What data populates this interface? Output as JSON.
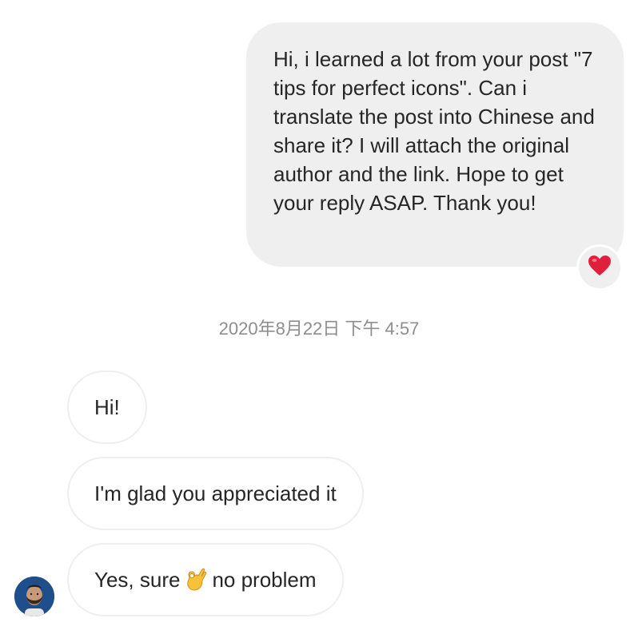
{
  "sent_message": {
    "text": "Hi, i learned a lot from your post \"7 tips for perfect icons\". Can i translate the post into Chinese and share it? I will attach the original author and the link. Hope to get your reply ASAP. Thank you!",
    "reaction_icon": "heart-icon"
  },
  "timestamp": "2020年8月22日 下午 4:57",
  "received_messages": [
    {
      "text": "Hi!"
    },
    {
      "text": "I'm glad you appreciated it"
    },
    {
      "before": "Yes, sure",
      "emoji_icon": "ok-hand-icon",
      "after": "no problem"
    }
  ],
  "avatar": {
    "icon": "avatar",
    "background": "#1f4e8c"
  },
  "colors": {
    "bubble_gray": "#efefef",
    "text": "#262626",
    "timestamp": "#8e8e8e",
    "heart": "#e0203a"
  }
}
